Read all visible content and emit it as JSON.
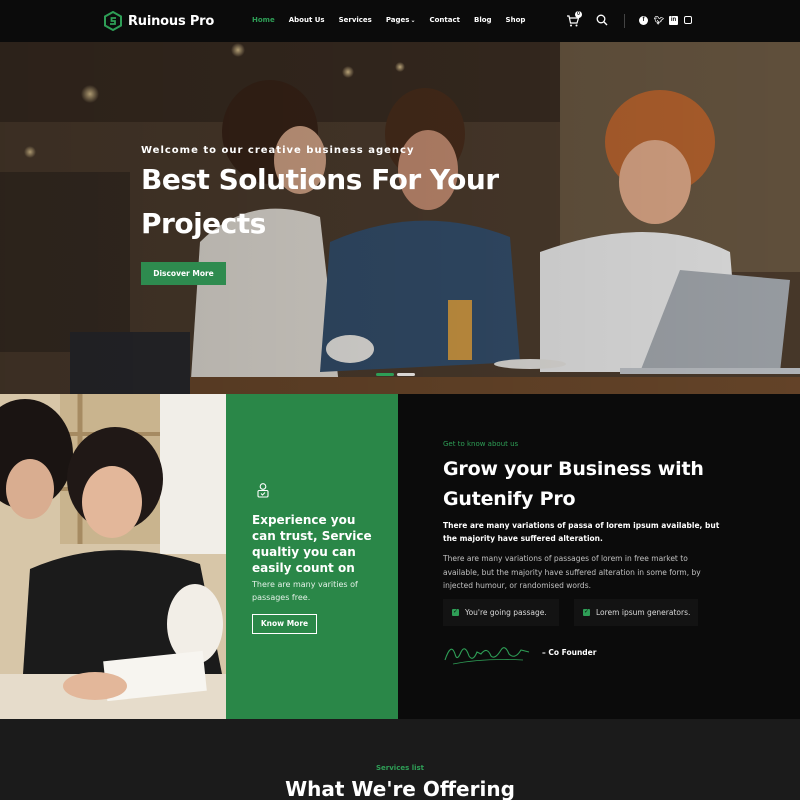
{
  "brand": {
    "name": "Ruinous Pro"
  },
  "nav": {
    "items": [
      {
        "label": "Home",
        "active": true
      },
      {
        "label": "About Us"
      },
      {
        "label": "Services"
      },
      {
        "label": "Pages"
      },
      {
        "label": "Contact"
      },
      {
        "label": "Blog"
      },
      {
        "label": "Shop"
      }
    ],
    "cart_count": "0",
    "icons": [
      "cart-icon",
      "search-icon",
      "facebook-icon",
      "twitter-icon",
      "linkedin-icon",
      "instagram-icon"
    ]
  },
  "hero": {
    "kicker": "Welcome to our creative business agency",
    "title": "Best Solutions For Your Projects",
    "button": "Discover More"
  },
  "green_card": {
    "title": "Experience you can trust, Service qualtiy you can easily count on",
    "text": "There are many varities of passages free.",
    "button": "Know More"
  },
  "about": {
    "kicker": "Get to know about us",
    "title": "Grow your Business with Gutenify Pro",
    "bold_text": "There are many variations of passa of lorem ipsum available, but the majority have suffered alteration.",
    "text": "There are many variations of passages of lorem in free market to available, but the majority have suffered alteration in some form, by injected humour, or randomised words.",
    "features": [
      "You're going passage.",
      "Lorem ipsum generators."
    ],
    "signature_label": "– Co Founder"
  },
  "services": {
    "kicker": "Services list",
    "title": "What We're Offering"
  },
  "colors": {
    "accent": "#2e9e56",
    "card_green": "#2a8748",
    "dark": "#0b0b0b"
  }
}
